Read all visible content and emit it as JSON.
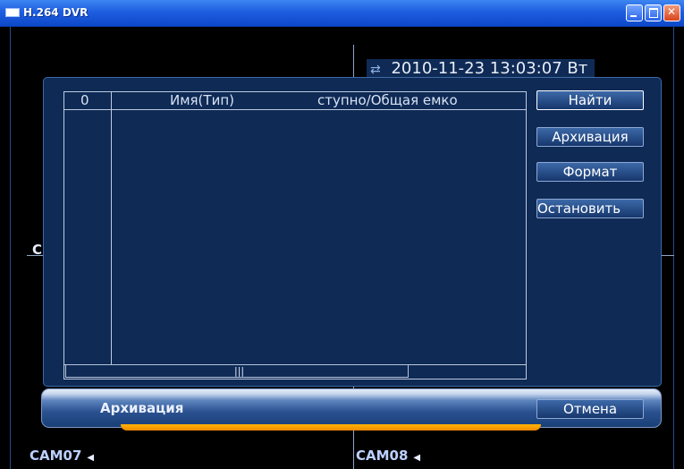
{
  "window": {
    "title": "H.264 DVR"
  },
  "overlay": {
    "datetime": "2010-11-23 13:03:07 Вт",
    "left_channel_letter": "C"
  },
  "cameras": [
    {
      "label": "CAM07"
    },
    {
      "label": "CAM08"
    }
  ],
  "backup_dialog": {
    "table_headers": [
      "0",
      "Имя(Тип)",
      "ступно/Общая емко"
    ],
    "buttons": {
      "find": "Найти",
      "backup": "Архивация",
      "format": "Формат",
      "stop": "Остановить",
      "cancel": "Отмена"
    },
    "title": "Архивация",
    "scroll_grip": "|||"
  },
  "colors": {
    "titlebar": "#1e5ee0",
    "panel": "#0e2a55",
    "accent": "#f08a00"
  },
  "icons": [
    "window-icon",
    "minimize-icon",
    "maximize-icon",
    "close-icon",
    "sync-icon",
    "speaker-icon"
  ]
}
